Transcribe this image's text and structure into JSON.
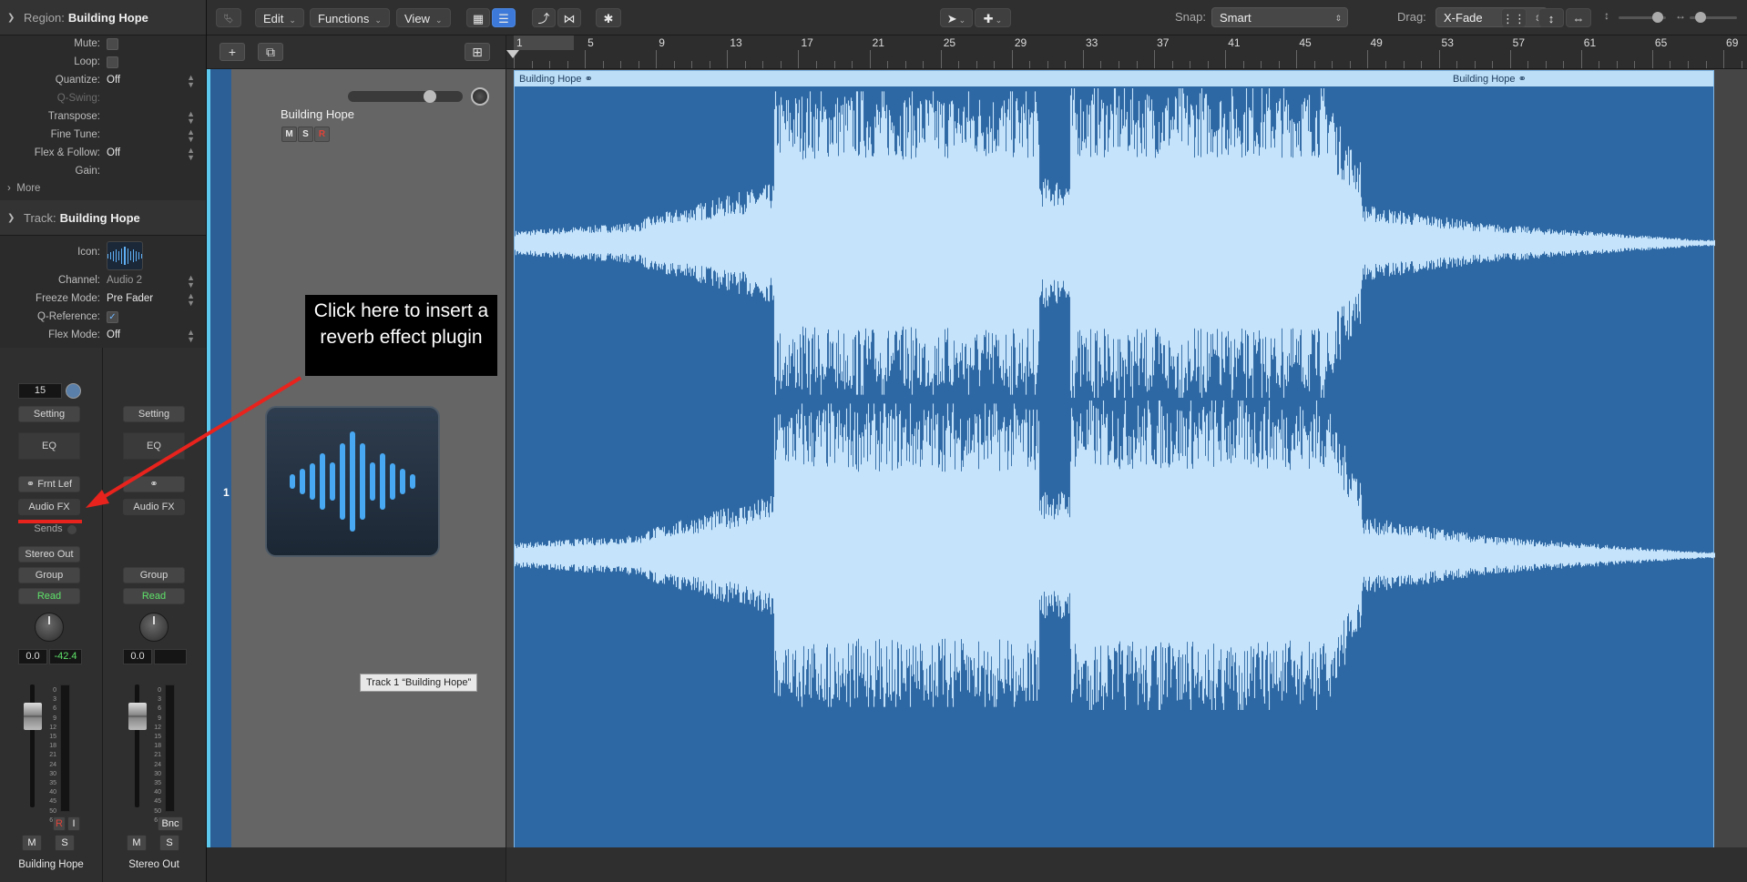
{
  "inspector": {
    "region_header": {
      "key": "Region:",
      "value": "Building Hope"
    },
    "region_rows": [
      {
        "label": "Mute:",
        "type": "checkbox",
        "checked": false
      },
      {
        "label": "Loop:",
        "type": "checkbox",
        "checked": false
      },
      {
        "label": "Quantize:",
        "value": "Off"
      },
      {
        "label": "Q-Swing:",
        "value": ""
      },
      {
        "label": "Transpose:",
        "value": ""
      },
      {
        "label": "Fine Tune:",
        "value": ""
      },
      {
        "label": "Flex & Follow:",
        "value": "Off"
      },
      {
        "label": "Gain:",
        "value": ""
      }
    ],
    "more_label": "More",
    "track_header": {
      "key": "Track:",
      "value": "Building Hope"
    },
    "track_rows": [
      {
        "label": "Icon:"
      },
      {
        "label": "Channel:",
        "value": "Audio 2"
      },
      {
        "label": "Freeze Mode:",
        "value": "Pre Fader"
      },
      {
        "label": "Q-Reference:",
        "type": "checkbox",
        "checked": true
      },
      {
        "label": "Flex Mode:",
        "value": "Off"
      }
    ]
  },
  "strips": [
    {
      "name": "Building Hope",
      "input_value": "15",
      "setting": "Setting",
      "eq": "EQ",
      "input": "Frnt Lef",
      "audio_fx": "Audio FX",
      "sends": "Sends",
      "output": "Stereo Out",
      "group": "Group",
      "automation": "Read",
      "volume": "0.0",
      "peak": "-42.4",
      "mute": "M",
      "solo": "S",
      "rec": "R",
      "input_mon": "I"
    },
    {
      "name": "Stereo Out",
      "setting": "Setting",
      "eq": "EQ",
      "audio_fx": "Audio FX",
      "group": "Group",
      "automation": "Read",
      "volume": "0.0",
      "bounce": "Bnc",
      "mute": "M",
      "solo": "S"
    }
  ],
  "meter_scale": [
    "0",
    "3",
    "6",
    "9",
    "12",
    "15",
    "18",
    "21",
    "24",
    "30",
    "35",
    "40",
    "45",
    "50",
    "60"
  ],
  "toolbar": {
    "edit": "Edit",
    "functions": "Functions",
    "view": "View",
    "snap_label": "Snap:",
    "snap_value": "Smart",
    "drag_label": "Drag:",
    "drag_value": "X-Fade"
  },
  "track": {
    "number": "1",
    "name": "Building Hope",
    "mute": "M",
    "solo": "S",
    "rec": "R",
    "tooltip": "Track 1 “Building Hope”"
  },
  "ruler": {
    "bars": [
      "1",
      "5",
      "9",
      "13",
      "17",
      "21",
      "25",
      "29",
      "33",
      "37",
      "41",
      "45",
      "49",
      "53",
      "57",
      "61",
      "65",
      "69"
    ]
  },
  "region": {
    "name": "Building Hope",
    "name_repeat": "Building Hope"
  },
  "annotation": {
    "text": "Click here to insert a reverb effect plugin",
    "color": "#e8231d"
  },
  "colors": {
    "region_fill": "#2e68a4",
    "waveform": "#c5e3fb",
    "accent": "#3d79d8"
  }
}
